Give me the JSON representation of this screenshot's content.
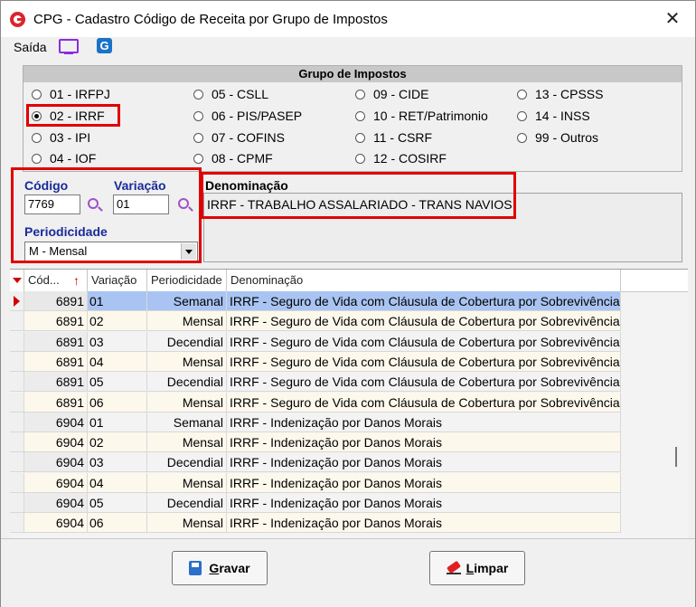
{
  "window": {
    "title": "CPG - Cadastro Código de Receita por Grupo de Impostos"
  },
  "toolbar": {
    "saida": "Saída",
    "icons": [
      "monitor-icon",
      "app-g-icon"
    ]
  },
  "grupo": {
    "header": "Grupo de Impostos",
    "selected": "02 - IRRF",
    "options": [
      "01 - IRFPJ",
      "02 - IRRF",
      "03 - IPI",
      "04 - IOF",
      "05 - CSLL",
      "06 - PIS/PASEP",
      "07 - COFINS",
      "08 - CPMF",
      "09 - CIDE",
      "10 - RET/Patrimonio",
      "11 - CSRF",
      "12 - COSIRF",
      "13 - CPSSS",
      "14 - INSS",
      "99 - Outros"
    ]
  },
  "form": {
    "codigo_label": "Código",
    "codigo_value": "7769",
    "variacao_label": "Variação",
    "variacao_value": "01",
    "periodicidade_label": "Periodicidade",
    "periodicidade_value": "M - Mensal",
    "denominacao_label": "Denominação",
    "denominacao_value": "IRRF - TRABALHO ASSALARIADO - TRANS NAVIOS"
  },
  "grid": {
    "columns": [
      "Cód...",
      "Variação",
      "Periodicidade",
      "Denominação"
    ],
    "rows": [
      {
        "cod": "6891",
        "var": "01",
        "per": "Semanal",
        "den": "IRRF - Seguro de Vida com Cláusula de Cobertura por Sobrevivência"
      },
      {
        "cod": "6891",
        "var": "02",
        "per": "Mensal",
        "den": "IRRF - Seguro de Vida com Cláusula de Cobertura por Sobrevivência"
      },
      {
        "cod": "6891",
        "var": "03",
        "per": "Decendial",
        "den": "IRRF - Seguro de Vida com Cláusula de Cobertura por Sobrevivência"
      },
      {
        "cod": "6891",
        "var": "04",
        "per": "Mensal",
        "den": "IRRF - Seguro de Vida com Cláusula de Cobertura por Sobrevivência"
      },
      {
        "cod": "6891",
        "var": "05",
        "per": "Decendial",
        "den": "IRRF - Seguro de Vida com Cláusula de Cobertura por Sobrevivência"
      },
      {
        "cod": "6891",
        "var": "06",
        "per": "Mensal",
        "den": "IRRF - Seguro de Vida com Cláusula de Cobertura por Sobrevivência"
      },
      {
        "cod": "6904",
        "var": "01",
        "per": "Semanal",
        "den": "IRRF - Indenização por Danos Morais"
      },
      {
        "cod": "6904",
        "var": "02",
        "per": "Mensal",
        "den": "IRRF - Indenização por Danos Morais"
      },
      {
        "cod": "6904",
        "var": "03",
        "per": "Decendial",
        "den": "IRRF - Indenização por Danos Morais"
      },
      {
        "cod": "6904",
        "var": "04",
        "per": "Mensal",
        "den": "IRRF - Indenização por Danos Morais"
      },
      {
        "cod": "6904",
        "var": "05",
        "per": "Decendial",
        "den": "IRRF - Indenização por Danos Morais"
      },
      {
        "cod": "6904",
        "var": "06",
        "per": "Mensal",
        "den": "IRRF - Indenização por Danos Morais"
      }
    ]
  },
  "buttons": {
    "gravar_first": "G",
    "gravar_rest": "ravar",
    "limpar_first": "L",
    "limpar_rest": "impar"
  },
  "colors": {
    "highlight_red": "#e10000",
    "selected_row": "#a9c4f2",
    "label_blue": "#1a2a9a"
  }
}
